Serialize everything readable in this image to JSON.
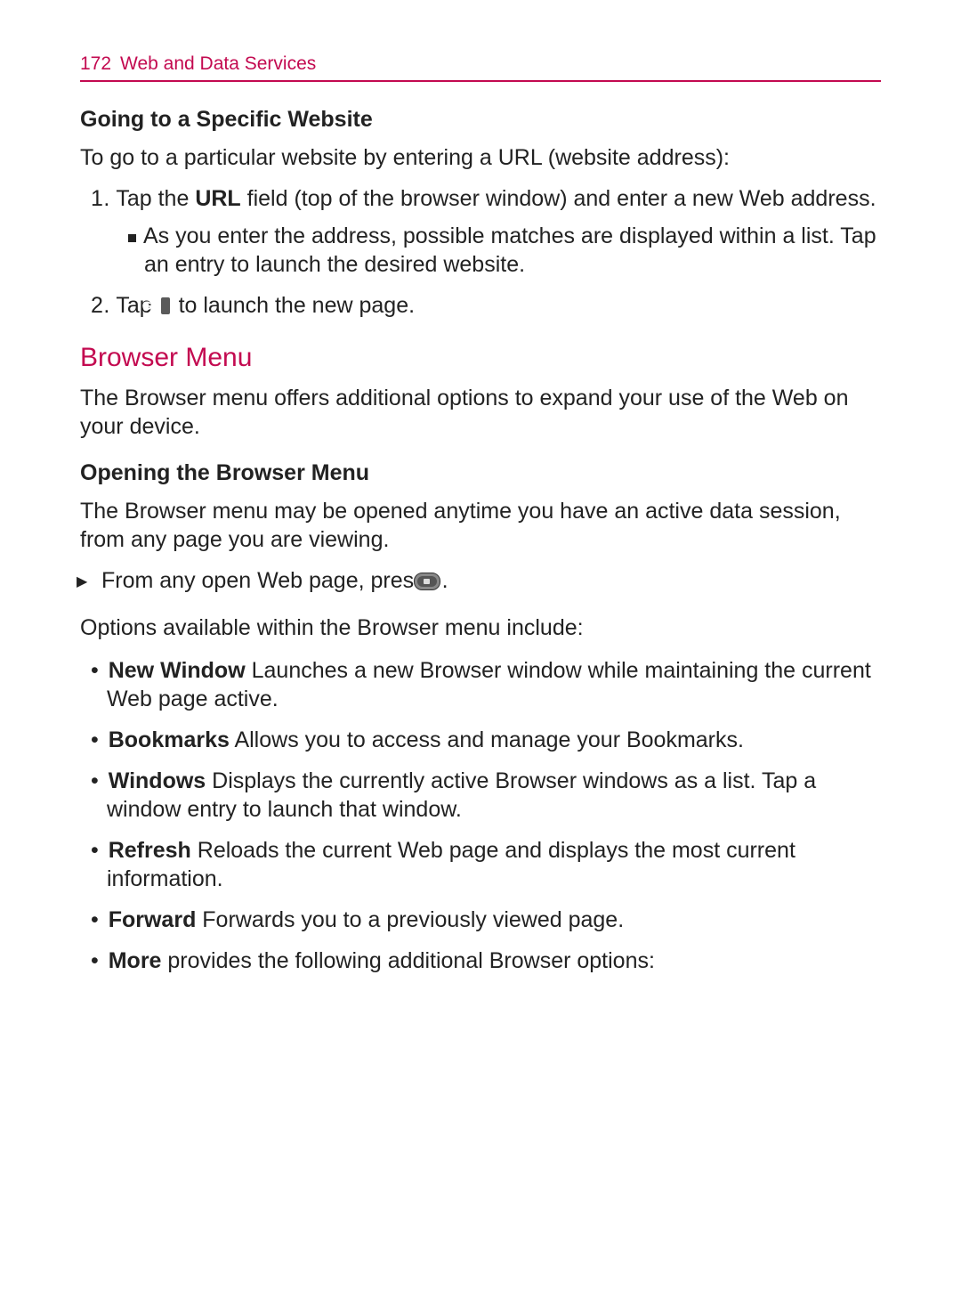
{
  "header": {
    "pageNumber": "172",
    "chapterTitle": "Web and Data Services"
  },
  "section1": {
    "heading": "Going to a Specific Website",
    "intro": "To go to a particular website by entering a URL (website address):",
    "step1_num": "1.",
    "step1_seg1": "Tap the ",
    "step1_bold": "URL",
    "step1_seg2": " field (top of the browser window) and enter a new Web address.",
    "step1_sub": "As you enter the address, possible matches are displayed within a list. Tap an entry to launch the desired website.",
    "step2_num": "2.",
    "step2_seg1": "Tap ",
    "step2_icon_label": "Go",
    "step2_seg2": " to launch the new page."
  },
  "section2": {
    "title": "Browser Menu",
    "intro": "The Browser menu offers additional options to expand your use of the Web on your device.",
    "openHeading": "Opening the Browser Menu",
    "openPara": "The Browser menu may be opened anytime you have an active data session, from any page you are viewing.",
    "triItem_seg1": "From any open Web page, press ",
    "triItem_seg2": ".",
    "optionsHeading": "Options available within the Browser menu include:",
    "items": {
      "i0_bold": "New Window",
      "i0_text": " Launches a new Browser window while maintaining the current Web page active.",
      "i1_bold": "Bookmarks",
      "i1_text": " Allows you to access and manage your Bookmarks.",
      "i2_bold": "Windows",
      "i2_text": " Displays the currently active Browser windows as a list. Tap a window entry to launch that window.",
      "i3_bold": "Refresh",
      "i3_text": " Reloads the current Web page and displays the most current information.",
      "i4_bold": "Forward",
      "i4_text": " Forwards you to a previously viewed page.",
      "i5_bold": "More",
      "i5_text": " provides the following additional Browser options:"
    }
  }
}
